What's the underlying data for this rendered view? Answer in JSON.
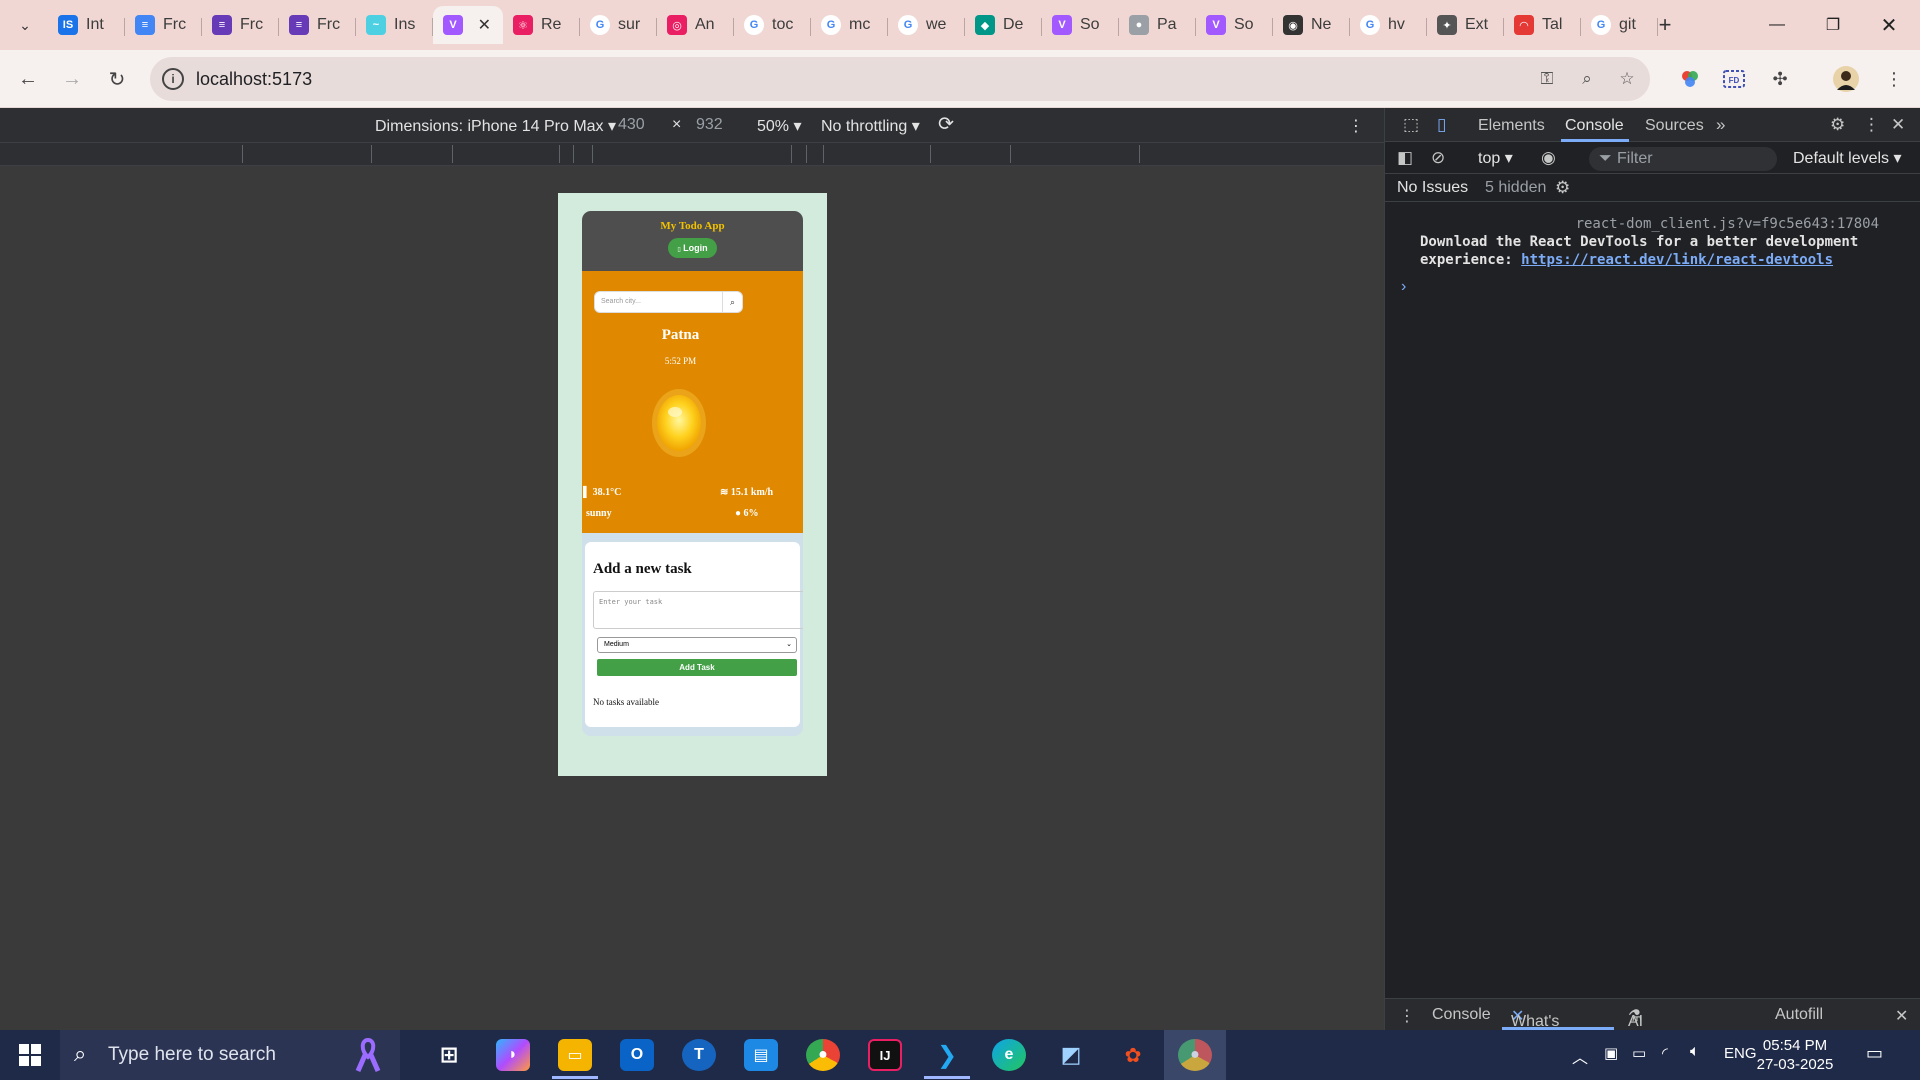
{
  "browser": {
    "tabs": [
      {
        "label": "Int",
        "fav": "IS",
        "color": "#1a73e8"
      },
      {
        "label": "Frc",
        "fav": "≡",
        "color": "#4285f4"
      },
      {
        "label": "Frc",
        "fav": "≡",
        "color": "#673ab7"
      },
      {
        "label": "Frc",
        "fav": "≡",
        "color": "#673ab7"
      },
      {
        "label": "Ins",
        "fav": "~",
        "color": "#4dd0e1"
      },
      {
        "label": "",
        "fav": "V",
        "color": "#a259ff",
        "active": true
      },
      {
        "label": "Re",
        "fav": "⚛",
        "color": "#e91e63"
      },
      {
        "label": "sur",
        "fav": "G",
        "color": "#ffffff"
      },
      {
        "label": "An",
        "fav": "◎",
        "color": "#e91e63"
      },
      {
        "label": "toc",
        "fav": "G",
        "color": "#ffffff"
      },
      {
        "label": "mc",
        "fav": "G",
        "color": "#ffffff"
      },
      {
        "label": "we",
        "fav": "G",
        "color": "#ffffff"
      },
      {
        "label": "De",
        "fav": "◆",
        "color": "#009688"
      },
      {
        "label": "So",
        "fav": "V",
        "color": "#a259ff"
      },
      {
        "label": "Pa",
        "fav": "●",
        "color": "#9aa0a6"
      },
      {
        "label": "So",
        "fav": "V",
        "color": "#a259ff"
      },
      {
        "label": "Ne",
        "fav": "◉",
        "color": "#333333"
      },
      {
        "label": "hv",
        "fav": "G",
        "color": "#ffffff"
      },
      {
        "label": "Ext",
        "fav": "✦",
        "color": "#555555"
      },
      {
        "label": "Tal",
        "fav": "◠",
        "color": "#e53935"
      },
      {
        "label": "git",
        "fav": "G",
        "color": "#ffffff"
      }
    ],
    "new_tab": "+",
    "url": "localhost:5173"
  },
  "device_toolbar": {
    "dimensions": "Dimensions: iPhone 14 Pro Max",
    "width": "430",
    "times": "×",
    "height": "932",
    "zoom": "50%",
    "throttle": "No throttling"
  },
  "app": {
    "title": "My Todo App",
    "login": "Login",
    "search_placeholder": "Search city...",
    "city": "Patna",
    "time": "5:52 PM",
    "temperature": "38.1°C",
    "wind": "15.1 km/h",
    "condition": "sunny",
    "humidity": "6%",
    "tasks_title": "Add a new task",
    "task_placeholder": "Enter your task",
    "priority": "Medium",
    "add_task": "Add Task",
    "empty": "No tasks available"
  },
  "devtools": {
    "tabs": [
      "Elements",
      "Console",
      "Sources"
    ],
    "active_tab": "Console",
    "context": "top",
    "filter": "Filter",
    "levels": "Default levels",
    "issues": "No Issues",
    "hidden": "5 hidden",
    "source": "react-dom_client.js?v=f9c5e643:17804",
    "message": "Download the React DevTools for a better development experience: ",
    "link": "https://react.dev/link/react-devtools",
    "drawer_tabs": [
      "Console",
      "What's new",
      "AI assistance",
      "Autofill"
    ]
  },
  "taskbar": {
    "search": "Type here to search",
    "lang": "ENG",
    "time": "05:54 PM",
    "date": "27-03-2025"
  }
}
